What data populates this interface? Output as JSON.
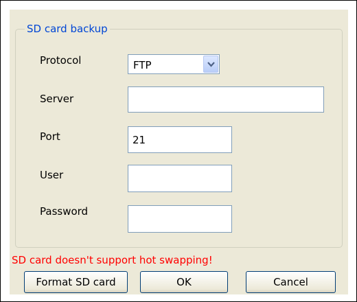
{
  "group": {
    "title": "SD card backup"
  },
  "labels": {
    "protocol": "Protocol",
    "server": "Server",
    "port": "Port",
    "user": "User",
    "password": "Password"
  },
  "fields": {
    "protocol_value": "FTP",
    "server_value": "",
    "port_value": "21",
    "user_value": "",
    "password_value": ""
  },
  "warning": "SD card doesn't support hot swapping!",
  "buttons": {
    "format": "Format SD card",
    "ok": "OK",
    "cancel": "Cancel"
  },
  "colors": {
    "group_title": "#0046d5",
    "warning": "#ff0000",
    "dialog_bg": "#ece9d8"
  },
  "icons": {
    "dropdown": "chevron-down-icon"
  }
}
